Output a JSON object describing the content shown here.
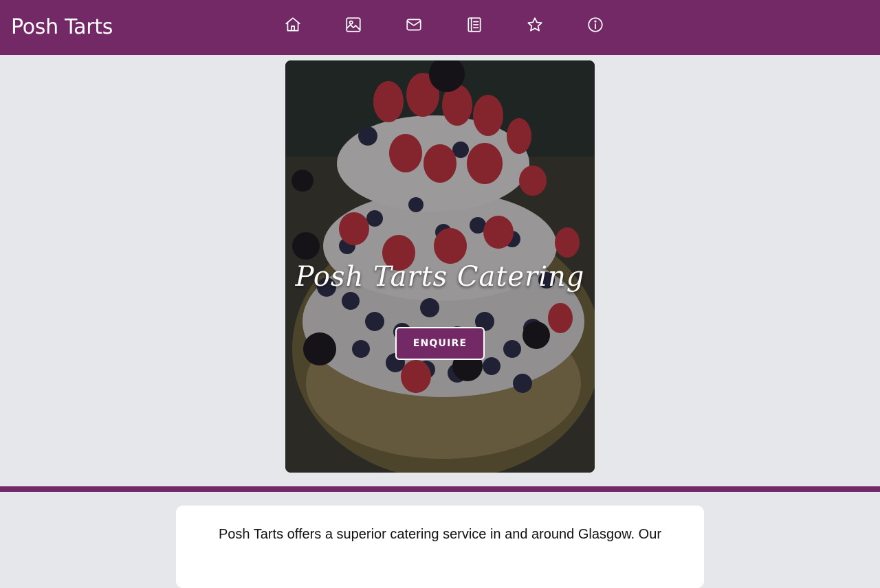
{
  "header": {
    "brand": "Posh Tarts",
    "background": "#722966",
    "nav": [
      {
        "icon": "home-icon"
      },
      {
        "icon": "image-icon"
      },
      {
        "icon": "mail-icon"
      },
      {
        "icon": "menu-book-icon"
      },
      {
        "icon": "star-icon"
      },
      {
        "icon": "info-icon"
      }
    ]
  },
  "hero": {
    "title": "Posh Tarts Catering",
    "button_label": "ENQUIRE",
    "image": "layered pavlova cake with strawberries, blueberries and blackberries"
  },
  "about": {
    "text": "Posh Tarts offers a superior catering service in and around Glasgow. Our"
  },
  "colors": {
    "accent": "#722966",
    "page_background": "#e5e7eb",
    "card_background": "#ffffff"
  }
}
